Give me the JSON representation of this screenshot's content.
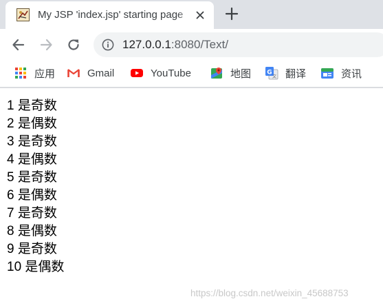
{
  "browser": {
    "tab": {
      "title": "My JSP 'index.jsp' starting page",
      "favicon": "jsp-page-icon"
    },
    "new_tab_label": "+",
    "address": {
      "host": "127.0.0.1",
      "rest": ":8080/Text/"
    }
  },
  "bookmarks": [
    {
      "label": "应用",
      "icon": "apps-grid-icon"
    },
    {
      "label": "Gmail",
      "icon": "gmail-icon"
    },
    {
      "label": "YouTube",
      "icon": "youtube-icon"
    },
    {
      "label": "地图",
      "icon": "maps-icon"
    },
    {
      "label": "翻译",
      "icon": "translate-icon"
    },
    {
      "label": "资讯",
      "icon": "news-icon"
    }
  ],
  "content": {
    "lines": [
      "1 是奇数",
      "2 是偶数",
      "3 是奇数",
      "4 是偶数",
      "5 是奇数",
      "6 是偶数",
      "7 是奇数",
      "8 是偶数",
      "9 是奇数",
      "10 是偶数"
    ]
  },
  "watermark": "https://blog.csdn.net/weixin_45688753",
  "colors": {
    "tab_strip": "#dee1e6",
    "omnibox": "#f1f3f4",
    "icon_gray": "#5f6368",
    "watermark": "#c8c8c8"
  }
}
